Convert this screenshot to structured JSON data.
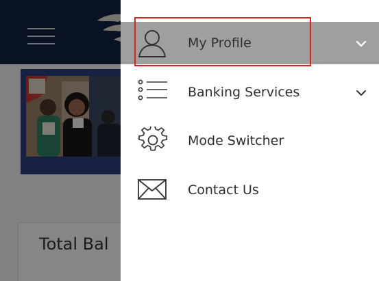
{
  "background": {
    "balance_title": "Total Bal"
  },
  "menu": {
    "items": [
      {
        "label": "My Profile",
        "icon": "user-icon",
        "expandable": true,
        "active": true
      },
      {
        "label": "Banking Services",
        "icon": "list-icon",
        "expandable": true,
        "active": false
      },
      {
        "label": "Mode Switcher",
        "icon": "gear-icon",
        "expandable": false,
        "active": false
      },
      {
        "label": "Contact Us",
        "icon": "envelope-icon",
        "expandable": false,
        "active": false
      }
    ]
  },
  "colors": {
    "header": "#12213f",
    "active_item": "#9f9f9f",
    "highlight": "#e32020",
    "text": "#2f2f2f"
  }
}
